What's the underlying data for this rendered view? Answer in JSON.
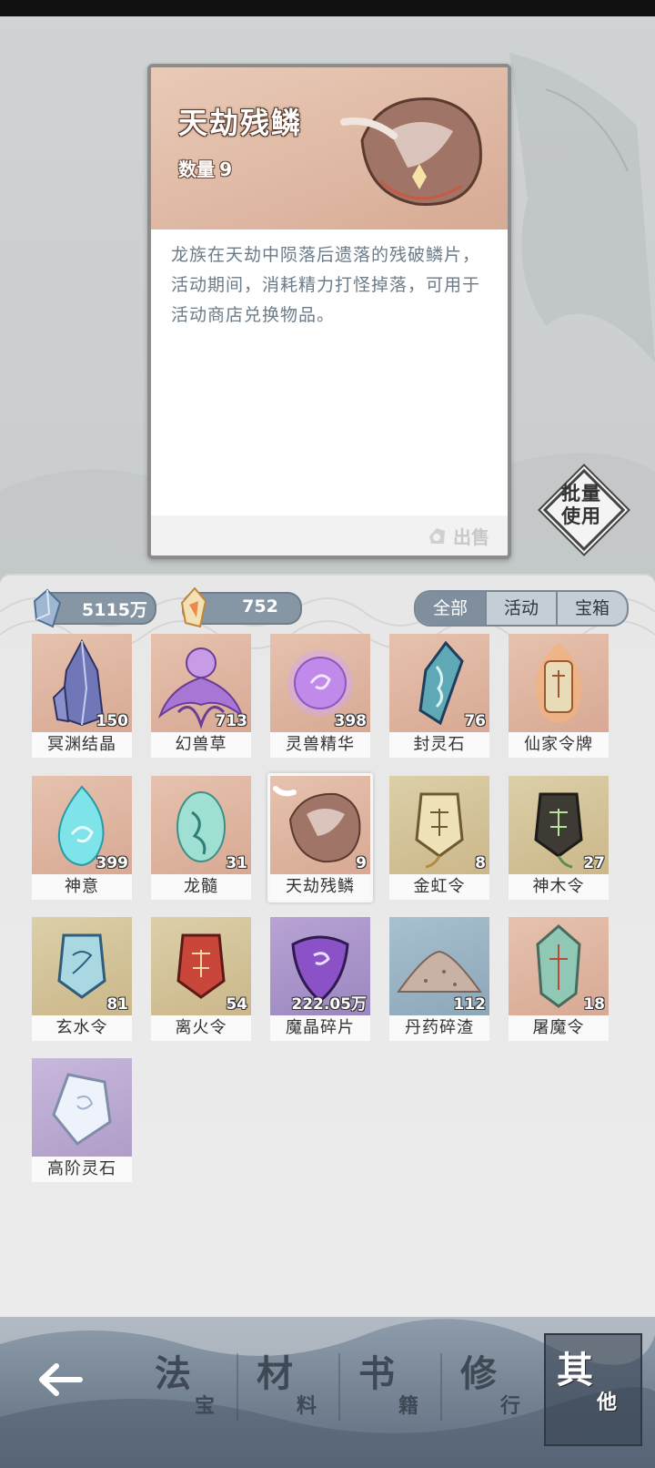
{
  "detail": {
    "name": "天劫残鳞",
    "qty_label": "数量",
    "qty_value": "9",
    "description": "龙族在天劫中陨落后遗落的残破鳞片，活动期间，消耗精力打怪掉落，可用于活动商店兑换物品。",
    "sell_label": "出售"
  },
  "batch_use": {
    "line1": "批量",
    "line2": "使用"
  },
  "currencies": [
    {
      "icon": "blue-crystal-icon",
      "value": "5115万"
    },
    {
      "icon": "gold-gem-icon",
      "value": "752"
    }
  ],
  "filters": [
    {
      "label": "全部",
      "active": true
    },
    {
      "label": "活动",
      "active": false
    },
    {
      "label": "宝箱",
      "active": false
    }
  ],
  "items": [
    {
      "name": "冥渊结晶",
      "count": "150",
      "icon": "dark-crystal-icon",
      "bg": "peach"
    },
    {
      "name": "幻兽草",
      "count": "713",
      "icon": "purple-herb-icon",
      "bg": "peach"
    },
    {
      "name": "灵兽精华",
      "count": "398",
      "icon": "violet-orb-icon",
      "bg": "peach"
    },
    {
      "name": "封灵石",
      "count": "76",
      "icon": "teal-stone-icon",
      "bg": "peach"
    },
    {
      "name": "仙家令牌",
      "count": "",
      "icon": "fire-token-icon",
      "bg": "peach"
    },
    {
      "name": "神意",
      "count": "399",
      "icon": "cyan-flame-icon",
      "bg": "peach"
    },
    {
      "name": "龙髓",
      "count": "31",
      "icon": "jade-dragon-icon",
      "bg": "peach"
    },
    {
      "name": "天劫残鳞",
      "count": "9",
      "icon": "dragon-scale-icon",
      "bg": "peach",
      "selected": true
    },
    {
      "name": "金虹令",
      "count": "8",
      "icon": "gold-token-icon",
      "bg": "gold"
    },
    {
      "name": "神木令",
      "count": "27",
      "icon": "wood-token-icon",
      "bg": "gold"
    },
    {
      "name": "玄水令",
      "count": "81",
      "icon": "water-token-icon",
      "bg": "gold"
    },
    {
      "name": "离火令",
      "count": "54",
      "icon": "fire-seal-icon",
      "bg": "gold"
    },
    {
      "name": "魔晶碎片",
      "count": "222.05万",
      "icon": "magic-shard-icon",
      "bg": "purple"
    },
    {
      "name": "丹药碎渣",
      "count": "112",
      "icon": "powder-pile-icon",
      "bg": "blue"
    },
    {
      "name": "屠魔令",
      "count": "18",
      "icon": "demon-token-icon",
      "bg": "peach"
    },
    {
      "name": "高阶灵石",
      "count": "",
      "icon": "spirit-stone-icon",
      "bg": "lilac"
    }
  ],
  "nav": {
    "back_icon": "back-arrow-icon",
    "tabs": [
      {
        "big": "法",
        "small": "宝",
        "active": false
      },
      {
        "big": "材",
        "small": "料",
        "active": false
      },
      {
        "big": "书",
        "small": "籍",
        "active": false
      },
      {
        "big": "修",
        "small": "行",
        "active": false
      },
      {
        "big": "其",
        "small": "他",
        "active": true
      }
    ]
  }
}
